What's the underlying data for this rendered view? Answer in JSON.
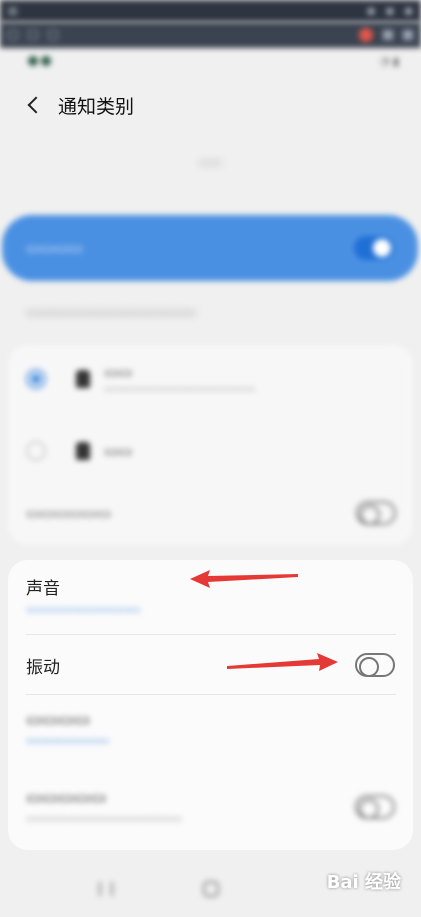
{
  "header": {
    "title": "通知类别"
  },
  "section_sound": {
    "title": "声音"
  },
  "section_vibration": {
    "title": "振动"
  },
  "watermark": {
    "text": "Bai 经验"
  },
  "colors": {
    "accent": "#4a90e2",
    "arrow": "#e53935"
  }
}
